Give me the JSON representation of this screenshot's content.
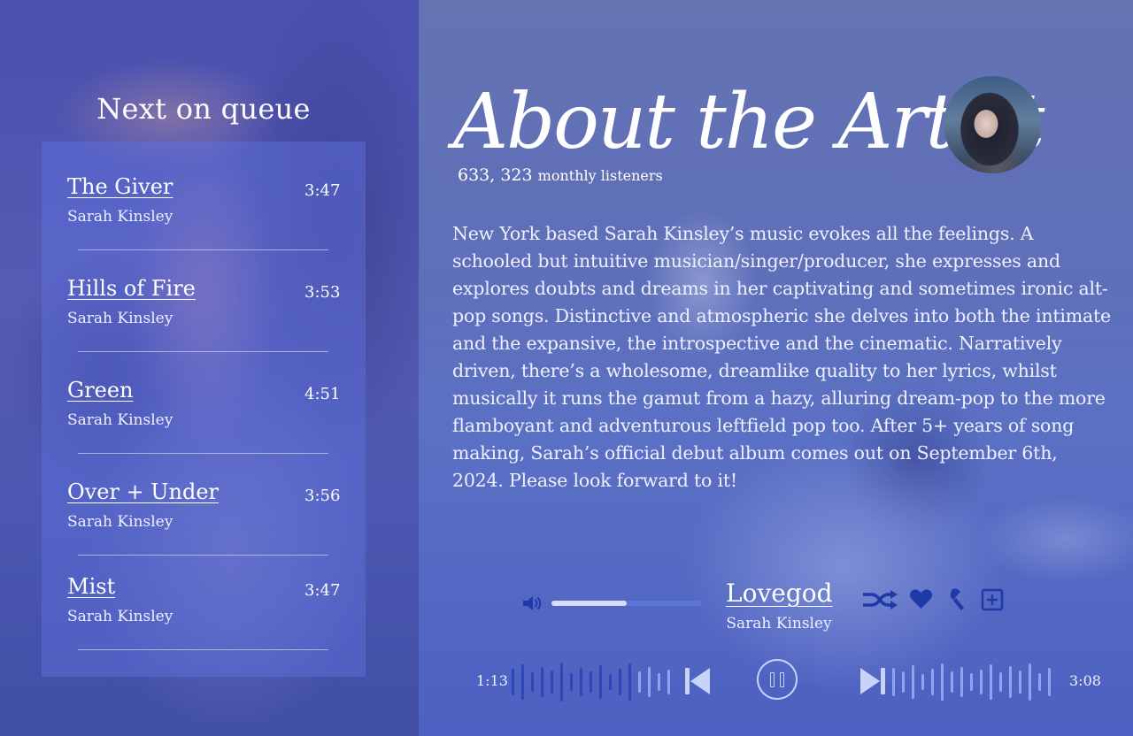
{
  "queue": {
    "title": "Next on queue",
    "items": [
      {
        "title": "The Giver",
        "artist": "Sarah Kinsley",
        "duration": "3:47"
      },
      {
        "title": "Hills of Fire",
        "artist": "Sarah Kinsley",
        "duration": "3:53"
      },
      {
        "title": "Green",
        "artist": "Sarah Kinsley",
        "duration": "4:51"
      },
      {
        "title": "Over + Under",
        "artist": "Sarah Kinsley",
        "duration": "3:56"
      },
      {
        "title": "Mist",
        "artist": "Sarah Kinsley",
        "duration": "3:47"
      }
    ]
  },
  "about": {
    "title": "About the Artist",
    "listeners_count": "633, 323",
    "listeners_label": "monthly listeners",
    "bio": "New York based Sarah Kinsley’s music evokes all the feelings. A schooled but intuitive musician/singer/producer, she expresses and explores doubts and dreams in her captivating and sometimes ironic alt-pop songs. Distinctive and atmospheric she delves into both the intimate and the expansive, the introspective and the cinematic. Narratively driven, there’s a wholesome, dreamlike quality to her lyrics, whilst musically it runs the gamut from a hazy, alluring dream-pop to the more flamboyant and adventurous leftfield pop too. After 5+ years of song making, Sarah’s official debut album comes out on September 6th, 2024. Please look forward to it!"
  },
  "player": {
    "track_title": "Lovegod",
    "track_artist": "Sarah Kinsley",
    "elapsed": "1:13",
    "total": "3:08",
    "volume": 0.5,
    "progress": 0.39,
    "state": "playing",
    "icons": {
      "volume": "volume-icon",
      "shuffle": "shuffle-icon",
      "like": "heart-icon",
      "lyrics": "microphone-icon",
      "add": "add-to-playlist-icon",
      "previous": "skip-previous-icon",
      "pause": "pause-icon",
      "next": "skip-next-icon"
    }
  },
  "colors": {
    "accent_dark": "#1f3aa8",
    "wave_played": "#2f46b8",
    "wave_unplayed": "#8ea4ee",
    "text": "#ffffff"
  }
}
